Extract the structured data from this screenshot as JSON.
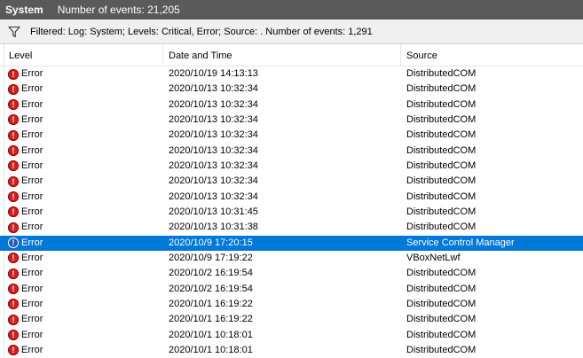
{
  "titlebar": {
    "log_name": "System",
    "event_count": "Number of events: 21,205"
  },
  "filter": {
    "icon": "filter-funnel-icon",
    "text": "Filtered: Log: System; Levels: Critical, Error; Source: . Number of events: 1,291"
  },
  "table": {
    "headers": {
      "level": "Level",
      "datetime": "Date and Time",
      "source": "Source"
    },
    "selected_index": 11,
    "rows": [
      {
        "level": "Error",
        "datetime": "2020/10/19 14:13:13",
        "source": "DistributedCOM"
      },
      {
        "level": "Error",
        "datetime": "2020/10/13 10:32:34",
        "source": "DistributedCOM"
      },
      {
        "level": "Error",
        "datetime": "2020/10/13 10:32:34",
        "source": "DistributedCOM"
      },
      {
        "level": "Error",
        "datetime": "2020/10/13 10:32:34",
        "source": "DistributedCOM"
      },
      {
        "level": "Error",
        "datetime": "2020/10/13 10:32:34",
        "source": "DistributedCOM"
      },
      {
        "level": "Error",
        "datetime": "2020/10/13 10:32:34",
        "source": "DistributedCOM"
      },
      {
        "level": "Error",
        "datetime": "2020/10/13 10:32:34",
        "source": "DistributedCOM"
      },
      {
        "level": "Error",
        "datetime": "2020/10/13 10:32:34",
        "source": "DistributedCOM"
      },
      {
        "level": "Error",
        "datetime": "2020/10/13 10:32:34",
        "source": "DistributedCOM"
      },
      {
        "level": "Error",
        "datetime": "2020/10/13 10:31:45",
        "source": "DistributedCOM"
      },
      {
        "level": "Error",
        "datetime": "2020/10/13 10:31:38",
        "source": "DistributedCOM"
      },
      {
        "level": "Error",
        "datetime": "2020/10/9 17:20:15",
        "source": "Service Control Manager"
      },
      {
        "level": "Error",
        "datetime": "2020/10/9 17:19:22",
        "source": "VBoxNetLwf"
      },
      {
        "level": "Error",
        "datetime": "2020/10/2 16:19:54",
        "source": "DistributedCOM"
      },
      {
        "level": "Error",
        "datetime": "2020/10/2 16:19:54",
        "source": "DistributedCOM"
      },
      {
        "level": "Error",
        "datetime": "2020/10/1 16:19:22",
        "source": "DistributedCOM"
      },
      {
        "level": "Error",
        "datetime": "2020/10/1 16:19:22",
        "source": "DistributedCOM"
      },
      {
        "level": "Error",
        "datetime": "2020/10/1 10:18:01",
        "source": "DistributedCOM"
      },
      {
        "level": "Error",
        "datetime": "2020/10/1 10:18:01",
        "source": "DistributedCOM"
      }
    ]
  },
  "colors": {
    "titlebar_bg": "#5a5a5a",
    "selection": "#0078d7",
    "error_icon": "#d21f1f"
  }
}
